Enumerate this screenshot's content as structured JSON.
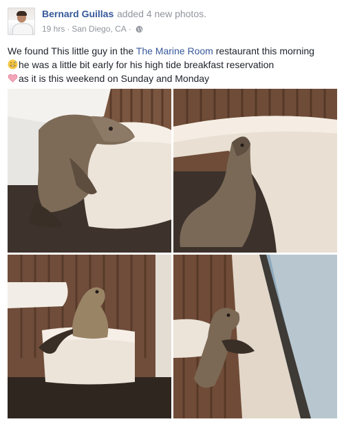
{
  "post": {
    "author": "Bernard Guillas",
    "action": "added 4 new photos.",
    "time": "19 hrs",
    "separator": "·",
    "location": "San Diego, CA",
    "privacy_separator": "·",
    "privacy_icon": "globe-icon",
    "text": {
      "line1_before": "We found This little guy in the ",
      "line1_link": "The Marine Room",
      "line1_after": " restaurant this morning",
      "line2_icon": "grinning-sweat-emoji-icon",
      "line2": "he was a little bit early for his high tide breakfast reservation",
      "line3_icon": "pink-heart-emoji-icon",
      "line3": "as it is this weekend on Sunday and Monday"
    },
    "photos": [
      {
        "subject": "sea lion pup resting head on booth seat"
      },
      {
        "subject": "sea lion pup leaning against curved booth"
      },
      {
        "subject": "sea lion pup sitting on booth seat"
      },
      {
        "subject": "sea lion pup looking out window"
      }
    ]
  },
  "colors": {
    "link": "#365899",
    "meta": "#90949c",
    "text": "#1d2129"
  }
}
